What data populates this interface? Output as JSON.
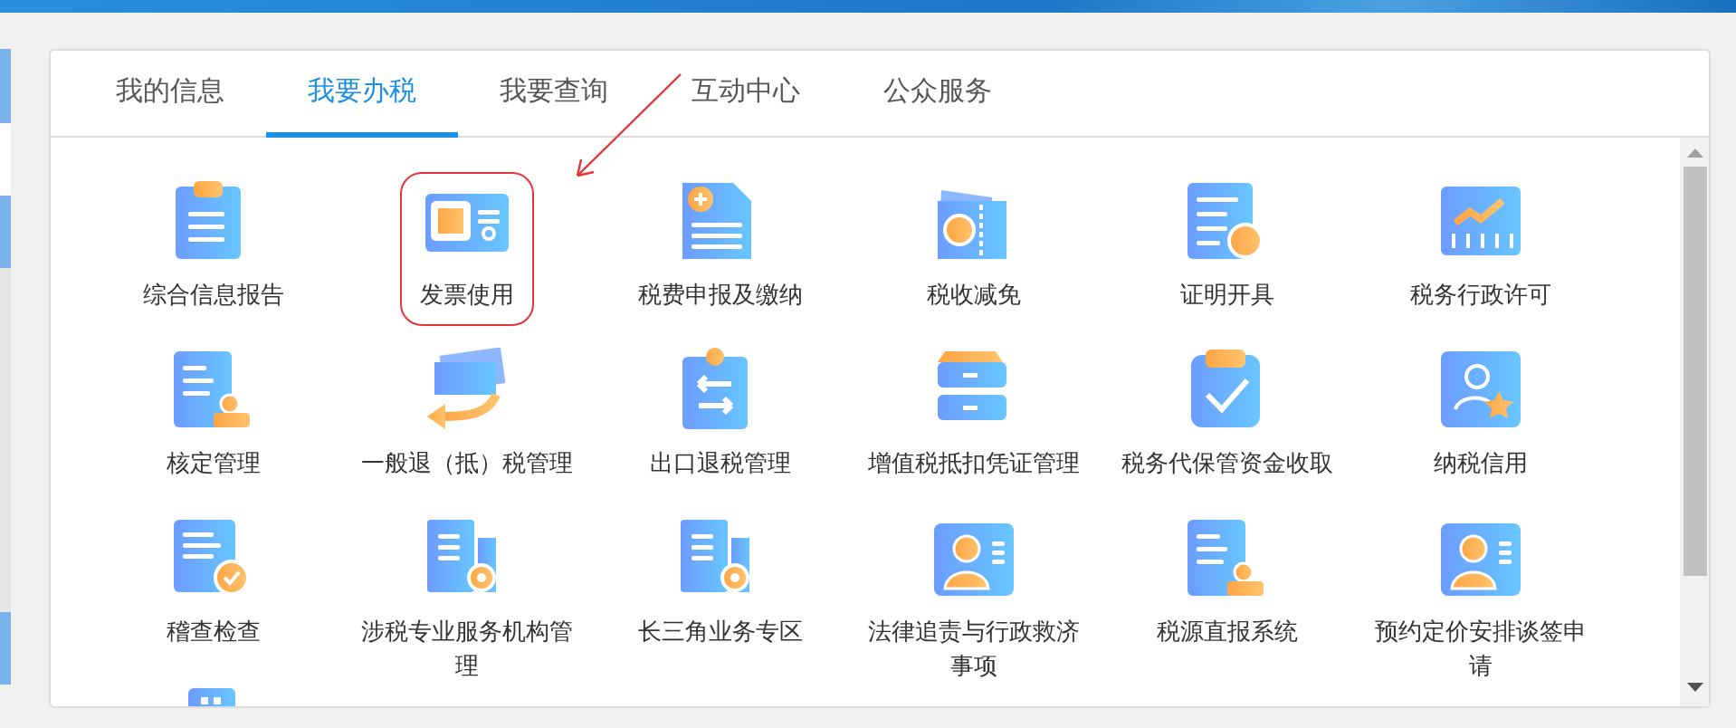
{
  "tabs": [
    {
      "label": "我的信息",
      "selected": false
    },
    {
      "label": "我要办税",
      "selected": true
    },
    {
      "label": "我要查询",
      "selected": false
    },
    {
      "label": "互动中心",
      "selected": false
    },
    {
      "label": "公众服务",
      "selected": false
    }
  ],
  "services": [
    {
      "label": "综合信息报告",
      "highlighted": false
    },
    {
      "label": "发票使用",
      "highlighted": true
    },
    {
      "label": "税费申报及缴纳",
      "highlighted": false
    },
    {
      "label": "税收减免",
      "highlighted": false
    },
    {
      "label": "证明开具",
      "highlighted": false
    },
    {
      "label": "税务行政许可",
      "highlighted": false
    },
    {
      "label": "核定管理",
      "highlighted": false
    },
    {
      "label": "一般退（抵）税管理",
      "highlighted": false
    },
    {
      "label": "出口退税管理",
      "highlighted": false
    },
    {
      "label": "增值税抵扣凭证管理",
      "highlighted": false
    },
    {
      "label": "税务代保管资金收取",
      "highlighted": false
    },
    {
      "label": "纳税信用",
      "highlighted": false
    },
    {
      "label": "稽查检查",
      "highlighted": false
    },
    {
      "label": "涉税专业服务机构管理",
      "highlighted": false
    },
    {
      "label": "长三角业务专区",
      "highlighted": false
    },
    {
      "label": "法律追责与行政救济事项",
      "highlighted": false
    },
    {
      "label": "税源直报系统",
      "highlighted": false
    },
    {
      "label": "预约定价安排谈签申请",
      "highlighted": false
    },
    {
      "highlighted": false
    }
  ]
}
